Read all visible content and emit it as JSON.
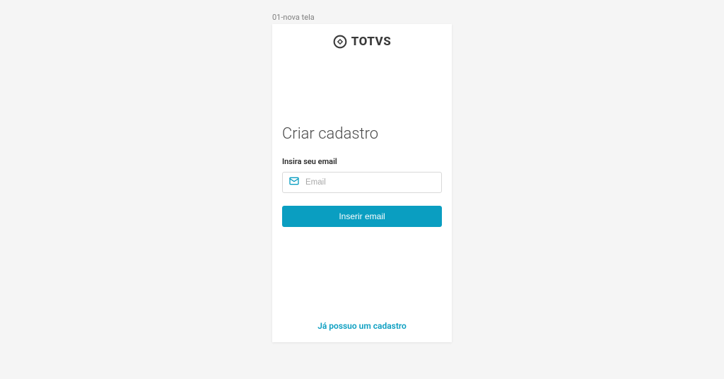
{
  "frame_label": "01-nova tela",
  "brand": {
    "name": "TOTVS"
  },
  "form": {
    "title": "Criar cadastro",
    "email_label": "Insira seu email",
    "email_placeholder": "Email",
    "submit_label": "Inserir email"
  },
  "footer": {
    "existing_account_link": "Já possuo um cadastro"
  }
}
